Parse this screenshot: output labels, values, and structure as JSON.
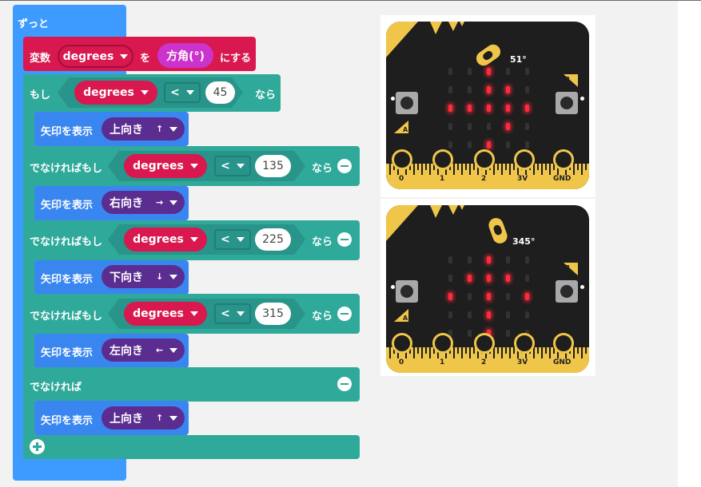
{
  "blocks": {
    "forever_label": "ずっと",
    "set_label": "変数",
    "var_name": "degrees",
    "to_label": "を",
    "compass_label": "方角(°)",
    "set_suffix": "にする",
    "if_label": "もし",
    "then_label": "なら",
    "elseif_label": "でなければもし",
    "else_label": "でなければ",
    "show_arrow_label": "矢印を表示",
    "operator": "<",
    "conditions": [
      {
        "value": "45",
        "arrow": "上向き",
        "arrow_glyph": "↑"
      },
      {
        "value": "135",
        "arrow": "右向き",
        "arrow_glyph": "→"
      },
      {
        "value": "225",
        "arrow": "下向き",
        "arrow_glyph": "↓"
      },
      {
        "value": "315",
        "arrow": "左向き",
        "arrow_glyph": "←"
      }
    ],
    "else_arrow": "上向き",
    "else_arrow_glyph": "↑",
    "add_icon": "plus-circle-icon",
    "remove_icon": "minus-circle-icon"
  },
  "colors": {
    "loop": "#3d9bff",
    "logic": "#2fa99a",
    "variable": "#d8184e",
    "input": "#cc33cc",
    "show": "#3a86f0",
    "arrow_picker": "#5c2d91"
  },
  "simulators": [
    {
      "angle": "51°",
      "leds_on": [
        [
          0,
          2
        ],
        [
          1,
          2
        ],
        [
          1,
          3
        ],
        [
          2,
          0
        ],
        [
          2,
          1
        ],
        [
          2,
          2
        ],
        [
          2,
          3
        ],
        [
          2,
          4
        ],
        [
          3,
          3
        ],
        [
          4,
          2
        ]
      ]
    },
    {
      "angle": "345°",
      "leds_on": [
        [
          0,
          2
        ],
        [
          1,
          1
        ],
        [
          1,
          2
        ],
        [
          1,
          3
        ],
        [
          2,
          0
        ],
        [
          2,
          2
        ],
        [
          2,
          4
        ],
        [
          3,
          2
        ],
        [
          4,
          2
        ]
      ]
    }
  ],
  "pins": [
    "0",
    "1",
    "2",
    "3V",
    "GND"
  ],
  "button_labels": [
    "A",
    "B"
  ]
}
